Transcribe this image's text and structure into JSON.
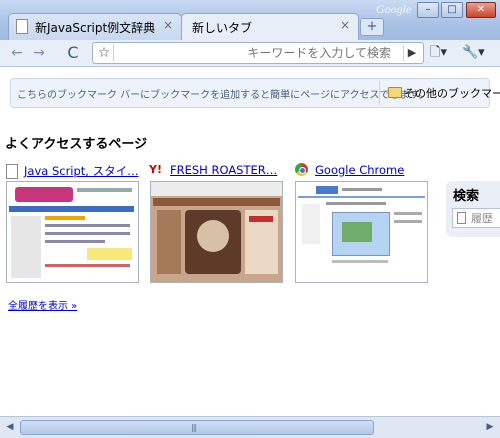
{
  "window": {
    "brand": "Google",
    "tabs": [
      {
        "label": "新JavaScript例文辞典",
        "active": false
      },
      {
        "label": "新しいタブ",
        "active": true
      }
    ],
    "close_glyph": "×",
    "new_tab_glyph": "+",
    "minimize_glyph": "–",
    "maximize_glyph": "□",
    "close_window_glyph": "✕"
  },
  "toolbar": {
    "back_glyph": "←",
    "forward_glyph": "→",
    "reload_glyph": "C",
    "star_glyph": "☆",
    "omnibox_placeholder": "キーワードを入力して検索",
    "go_glyph": "▶",
    "page_menu_glyph": "🗋▾",
    "tools_menu_glyph": "🔧▾"
  },
  "bookmark_bar": {
    "hint": "こちらのブックマーク バーにブックマークを追加すると簡単にページにアクセスできます。",
    "other_label": "その他のブックマーク"
  },
  "most_visited": {
    "title": "よくアクセスするページ",
    "tiles": [
      {
        "label": "Java Script, スタイ…",
        "icon": "page-icon"
      },
      {
        "label": "FRESH ROASTER…",
        "icon": "yahoo-icon"
      },
      {
        "label": "Google Chrome",
        "icon": "chrome-icon"
      }
    ],
    "history_link": "全履歴を表示 »"
  },
  "search_panel": {
    "title": "検索",
    "input_text": "履歴"
  },
  "scrollbar": {
    "left_glyph": "◀",
    "right_glyph": "▶",
    "grip": "|||"
  },
  "colors": {
    "frame": "#a9c2e6",
    "link": "#0000cc",
    "bookmark_bar_bg": "#eef3fb"
  }
}
